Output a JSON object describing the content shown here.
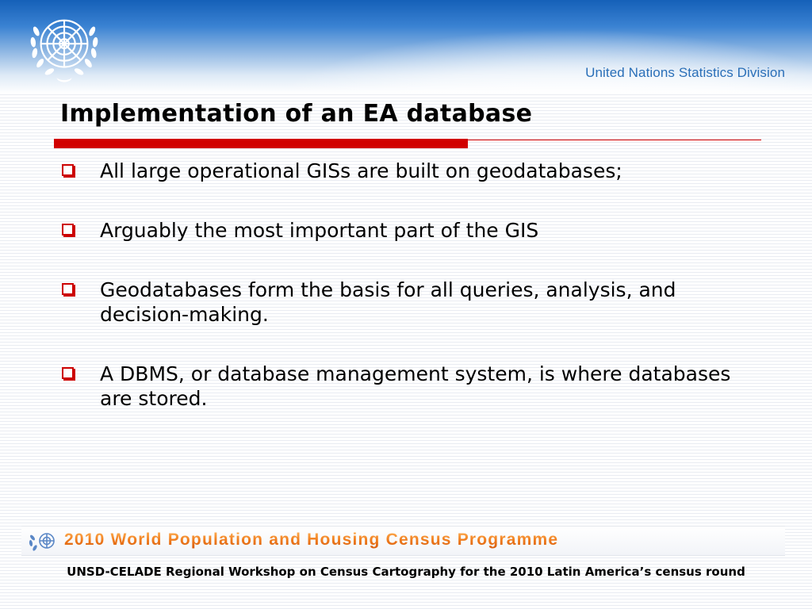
{
  "header": {
    "organization": "United Nations Statistics Division",
    "logo_icon": "un-emblem-icon"
  },
  "slide": {
    "title": "Implementation of an EA database",
    "bullets": [
      "All large operational GISs are built on geodatabases;",
      "Arguably the most important part of the GIS",
      "Geodatabases form the basis for all queries, analysis, and decision-making.",
      "A DBMS, or database management system, is where databases are stored."
    ],
    "bullet_icon": "checkbox-bullet-icon"
  },
  "footer": {
    "banner": "2010 World Population and Housing Census Programme",
    "workshop": "UNSD-CELADE Regional Workshop on Census Cartography for the 2010 Latin America’s census round"
  },
  "colors": {
    "header_blue": "#1560b8",
    "accent_red": "#d10000",
    "banner_orange": "#f07d1e",
    "division_text": "#2a6fb8"
  }
}
